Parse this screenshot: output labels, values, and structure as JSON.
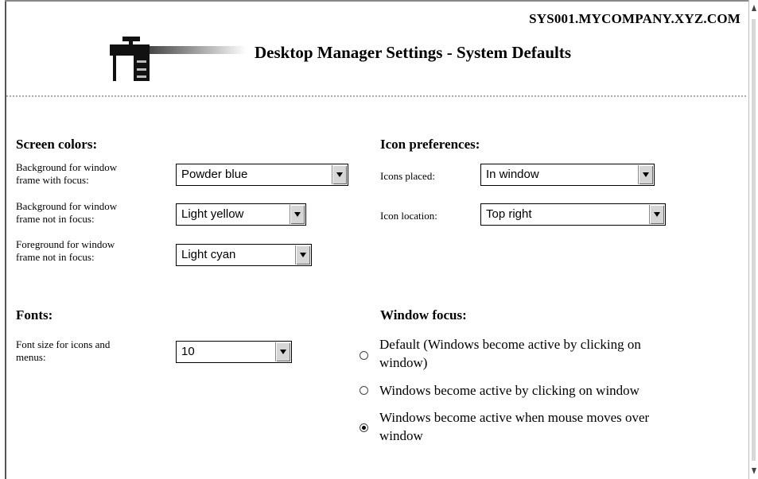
{
  "header": {
    "host": "SYS001.MYCOMPANY.XYZ.COM",
    "title": "Desktop Manager Settings - System Defaults",
    "logo_icon": "desk-icon"
  },
  "screen_colors": {
    "title": "Screen colors:",
    "bg_focus": {
      "label_line1": "Background for window",
      "label_line2": "frame with focus:",
      "value": "Powder blue"
    },
    "bg_not_focus": {
      "label_line1": "Background for window",
      "label_line2": "frame not in focus:",
      "value": "Light yellow"
    },
    "fg_not_focus": {
      "label_line1": "Foreground for window",
      "label_line2": "frame not in focus:",
      "value": "Light cyan"
    }
  },
  "icon_preferences": {
    "title": "Icon preferences:",
    "placed": {
      "label": "Icons placed:",
      "value": "In window"
    },
    "location": {
      "label": "Icon location:",
      "value": "Top right"
    }
  },
  "fonts": {
    "title": "Fonts:",
    "size": {
      "label_line1": "Font size for icons and",
      "label_line2": "menus:",
      "value": "10"
    }
  },
  "window_focus": {
    "title": "Window focus:",
    "options": [
      {
        "line1": "Default (Windows become active by clicking on",
        "line2": "window)",
        "checked": false
      },
      {
        "line1": "Windows become active by clicking on window",
        "line2": "",
        "checked": false
      },
      {
        "line1": "Windows become active when mouse moves over",
        "line2": "window",
        "checked": true
      }
    ]
  }
}
